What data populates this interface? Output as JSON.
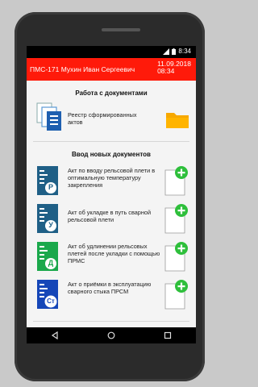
{
  "status": {
    "time": "8:34"
  },
  "appbar": {
    "title": "ПМС-171  Мухин Иван Сергеевич",
    "date": "11.09.2018",
    "time": "08:34"
  },
  "work_docs": {
    "title": "Работа с документами",
    "registry_label": "Реестр сформированных актов"
  },
  "new_docs": {
    "title": "Ввод новых документов",
    "items": [
      {
        "letter": "Р",
        "label": "Акт по вводу рельсовой плети в оптимальную температуру закрепления",
        "color": "#1f5f86"
      },
      {
        "letter": "У",
        "label": "Акт об укладке в путь сварной рельсовой плети",
        "color": "#1f5f86"
      },
      {
        "letter": "Д",
        "label": "Акт об удлинении рельсовых плетей после укладки с помощью ПРМС",
        "color": "#1aa84b"
      },
      {
        "letter": "Ст",
        "label": "Акт о приёмки в эксплуатацию сварного стыка ПРСМ",
        "color": "#1546b8"
      }
    ]
  },
  "colors": {
    "appbar": "#ff1a0a",
    "accent_green": "#2ebf3b",
    "folder": "#f7a800"
  }
}
